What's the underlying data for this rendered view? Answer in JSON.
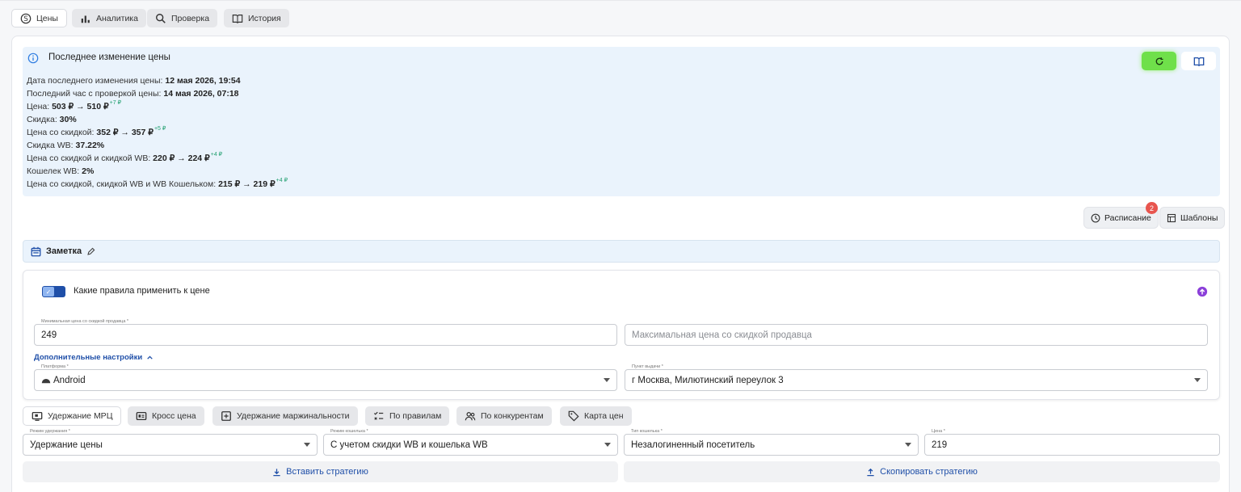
{
  "tabs": [
    {
      "label": "Цены",
      "icon": "price-icon",
      "active": true
    },
    {
      "label": "Аналитика",
      "icon": "bar-chart-icon"
    },
    {
      "label": "Проверка",
      "icon": "search-icon"
    },
    {
      "label": "История",
      "icon": "book-icon"
    }
  ],
  "info": {
    "title": "Последнее изменение цены",
    "lines": [
      {
        "label": "Дата последнего изменения цены:",
        "value": "12 мая 2026, 19:54",
        "delta": ""
      },
      {
        "label": "Последний час с проверкой цены:",
        "value": "14 мая 2026, 07:18",
        "delta": ""
      },
      {
        "label": "Цена:",
        "value": "503 ₽ → 510 ₽",
        "delta": "+7 ₽"
      },
      {
        "label": "Скидка:",
        "value": "30%",
        "delta": ""
      },
      {
        "label": "Цена со скидкой:",
        "value": "352 ₽ → 357 ₽",
        "delta": "+5 ₽"
      },
      {
        "label": "Скидка WB:",
        "value": "37.22%",
        "delta": ""
      },
      {
        "label": "Цена со скидкой и скидкой WB:",
        "value": "220 ₽ → 224 ₽",
        "delta": "+4 ₽"
      },
      {
        "label": "Кошелек WB:",
        "value": "2%",
        "delta": ""
      },
      {
        "label": "Цена со скидкой, скидкой WB и WB Кошельком:",
        "value": "215 ₽ → 219 ₽",
        "delta": "+4 ₽"
      }
    ]
  },
  "actions": {
    "schedule_label": "Расписание",
    "schedule_badge": "2",
    "templates_label": "Шаблоны"
  },
  "note": {
    "label": "Заметка"
  },
  "rules": {
    "title": "Какие правила применить к цене",
    "min_price_label": "Минимальная цена со скидкой продавца *",
    "min_price_value": "249",
    "max_price_placeholder": "Максимальная цена со скидкой продавца",
    "advanced_label": "Дополнительные настройки",
    "platform_label": "Платформа *",
    "platform_value": "Android",
    "pickup_label": "Пункт выдачи *",
    "pickup_value": "г Москва, Милютинский переулок 3"
  },
  "strategy_tabs": [
    {
      "label": "Удержание МРЦ",
      "icon": "monitor-icon",
      "active": true
    },
    {
      "label": "Кросс цена",
      "icon": "card-icon"
    },
    {
      "label": "Удержание маржинальности",
      "icon": "margin-icon"
    },
    {
      "label": "По правилам",
      "icon": "rules-icon"
    },
    {
      "label": "По конкурентам",
      "icon": "users-icon"
    },
    {
      "label": "Карта цен",
      "icon": "tag-icon"
    }
  ],
  "strategy": {
    "hold_mode_label": "Режим удержания *",
    "hold_mode_value": "Удержание цены",
    "wallet_mode_label": "Режим кошелька *",
    "wallet_mode_value": "С учетом скидки WB и кошелька WB",
    "wallet_type_label": "Тип кошелька *",
    "wallet_type_value": "Незалогиненный посетитель",
    "price_label": "Цена *",
    "price_value": "219",
    "insert_label": "Вставить стратегию",
    "copy_label": "Скопировать стратегию"
  },
  "colors": {
    "accent": "#1f4fa8",
    "green": "#6fe04a",
    "info_bg": "#eaf3fc",
    "delta": "#1e9e6e",
    "badge": "#e8554e"
  }
}
